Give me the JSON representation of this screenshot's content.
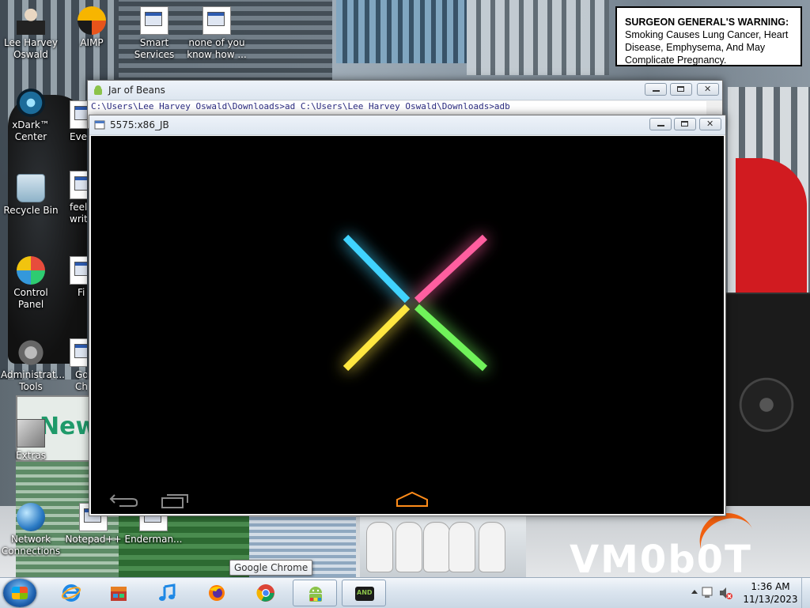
{
  "desktop_icons": [
    {
      "label": "Lee Harvey Oswald",
      "icon": "person-icon"
    },
    {
      "label": "AIMP",
      "icon": "aimp-icon"
    },
    {
      "label": "Smart Services",
      "icon": "gear-doc-icon"
    },
    {
      "label": "none of you know how ...",
      "icon": "document-icon"
    },
    {
      "label": "xDark™ Center",
      "icon": "xdark-icon"
    },
    {
      "label": "Ever",
      "icon": "document-icon"
    },
    {
      "label": "Recycle Bin",
      "icon": "recycle-bin-icon"
    },
    {
      "label": "feel writ",
      "icon": "document-icon"
    },
    {
      "label": "Control Panel",
      "icon": "control-panel-icon"
    },
    {
      "label": "Fi",
      "icon": "document-icon"
    },
    {
      "label": "Administrat... Tools",
      "icon": "admin-tools-icon"
    },
    {
      "label": "Go Ch",
      "icon": "document-icon"
    },
    {
      "label": "Extras",
      "icon": "extras-icon"
    },
    {
      "label": "Network Connections",
      "icon": "network-icon"
    },
    {
      "label": "Notepad++",
      "icon": "notepad-icon"
    },
    {
      "label": "Enderman...",
      "icon": "document-icon"
    }
  ],
  "warning": {
    "heading": "SURGEON GENERAL'S WARNING:",
    "body": "Smoking Causes Lung Cancer, Heart Disease, Emphysema, And May Complicate Pregnancy."
  },
  "wallpaper_text": {
    "news": "New",
    "logo": "VM0b0T"
  },
  "windows": {
    "jar": {
      "title": "Jar of Beans",
      "command": "C:\\Users\\Lee Harvey Oswald\\Downloads>ad C:\\Users\\Lee Harvey Oswald\\Downloads>adb"
    },
    "emulator": {
      "title": "5575:x86_JB",
      "boot_colors": [
        "#3fd3ff",
        "#ff5fa0",
        "#ffe740",
        "#6ff25a"
      ]
    }
  },
  "taskbar": {
    "items": [
      {
        "name": "internet-explorer",
        "icon": "ie-icon"
      },
      {
        "name": "app-store",
        "icon": "store-icon"
      },
      {
        "name": "music",
        "icon": "music-icon"
      },
      {
        "name": "firefox",
        "icon": "firefox-icon"
      },
      {
        "name": "google-chrome",
        "icon": "chrome-icon"
      },
      {
        "name": "jar-of-beans",
        "icon": "android-icon"
      },
      {
        "name": "emulator",
        "icon": "and-icon"
      }
    ],
    "android_badge": "AND",
    "tooltip": "Google Chrome",
    "clock": {
      "time": "1:36 AM",
      "date": "11/13/2023"
    }
  },
  "colors": {
    "taskbar": "#dbe5ef",
    "title_bar": "#eef3fa",
    "home_button": "#ff8c1a"
  }
}
